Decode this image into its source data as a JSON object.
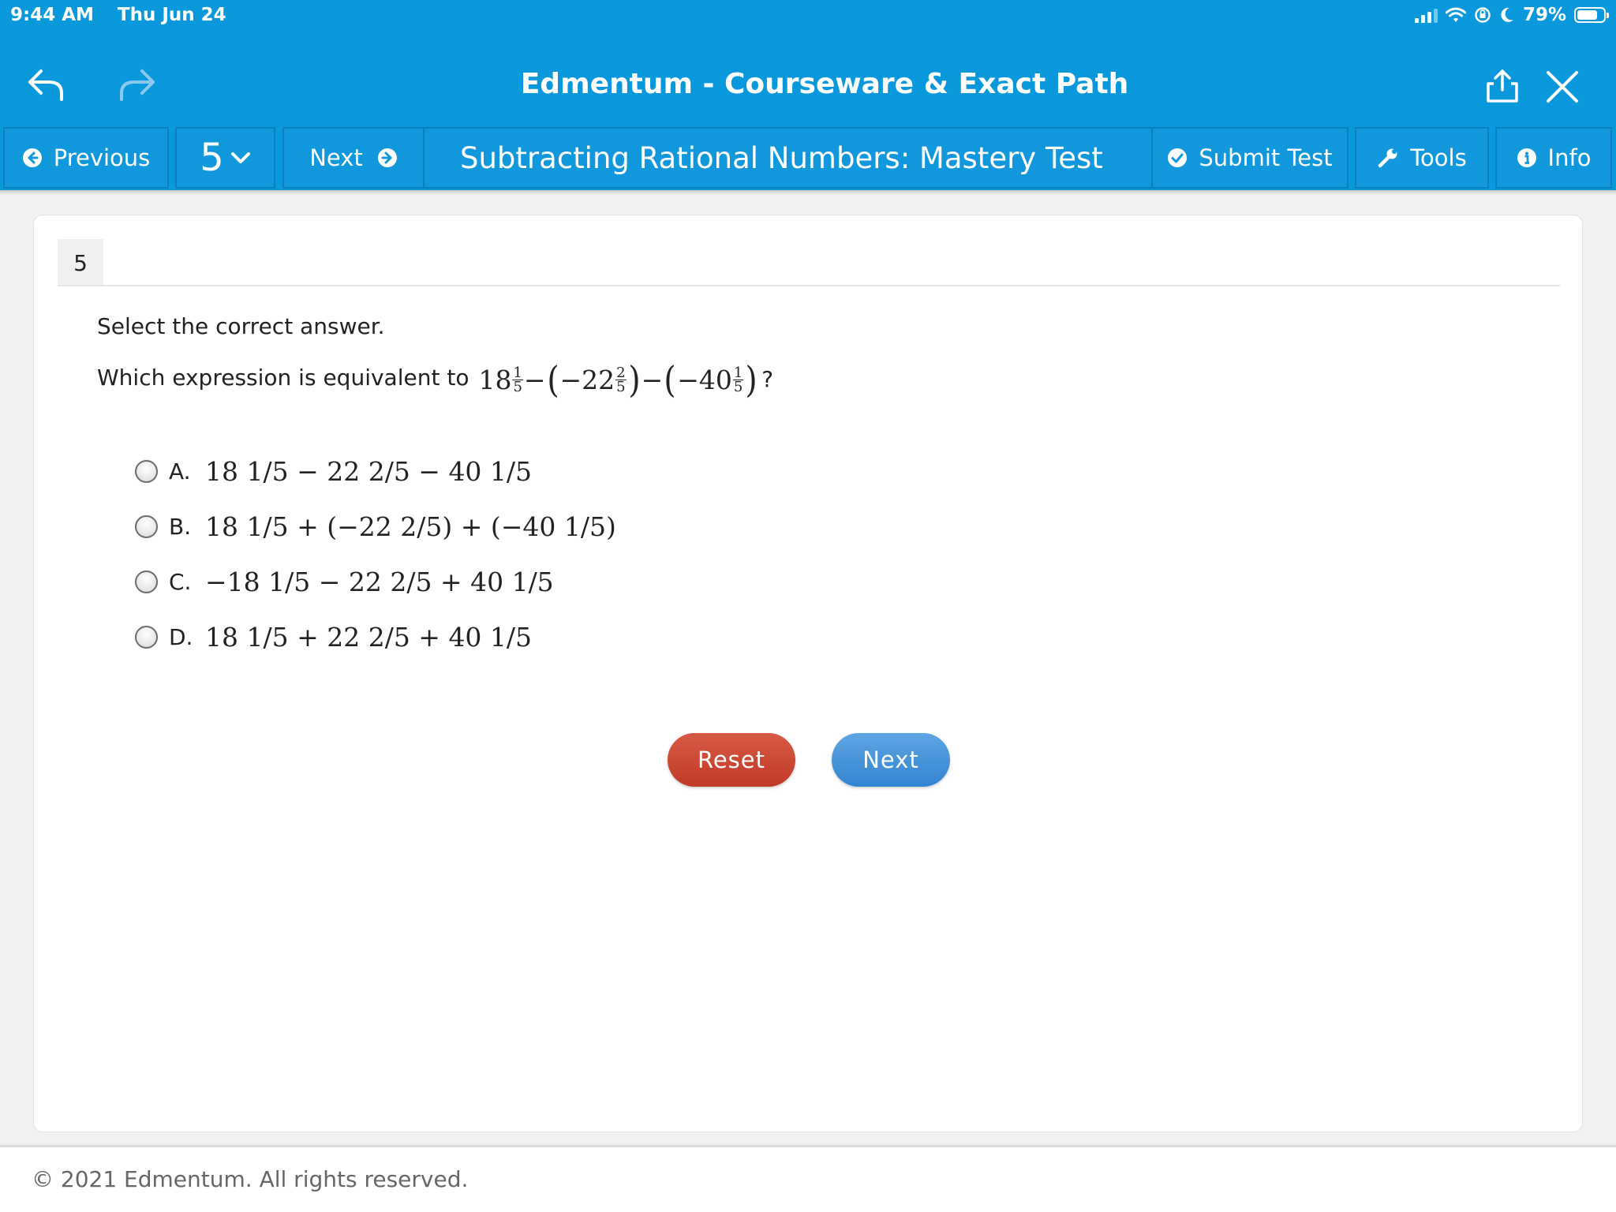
{
  "status_bar": {
    "time": "9:44 AM",
    "date": "Thu Jun 24",
    "battery": "79%",
    "battery_level": 0.79
  },
  "app_bar": {
    "title": "Edmentum - Courseware & Exact Path"
  },
  "toolbar": {
    "previous_label": "Previous",
    "question_number": "5",
    "next_label": "Next",
    "test_title": "Subtracting Rational Numbers: Mastery Test",
    "submit_label": "Submit Test",
    "tools_label": "Tools",
    "info_label": "Info"
  },
  "question": {
    "number": "5",
    "instruction": "Select the correct answer.",
    "stem_text": "Which expression is equivalent to",
    "stem_suffix": "?",
    "stem_expr": [
      "18",
      "1",
      "5",
      "−",
      "(",
      "−22",
      "2",
      "5",
      ")",
      "−",
      "(",
      "−40",
      "1",
      "5",
      ")"
    ],
    "options": [
      {
        "letter": "A.",
        "expr": "18 1/5 − 22 2/5 − 40 1/5"
      },
      {
        "letter": "B.",
        "expr": "18 1/5 + (−22 2/5) + (−40 1/5)"
      },
      {
        "letter": "C.",
        "expr": "−18 1/5 − 22 2/5 + 40 1/5"
      },
      {
        "letter": "D.",
        "expr": "18 1/5 + 22 2/5 + 40 1/5"
      }
    ]
  },
  "buttons": {
    "reset": "Reset",
    "next": "Next"
  },
  "footer": {
    "copyright": "© 2021 Edmentum. All rights reserved."
  },
  "colors": {
    "brand_blue": "#0a98dd",
    "reset_red": "#c9452f",
    "next_blue": "#3f8fd8"
  }
}
